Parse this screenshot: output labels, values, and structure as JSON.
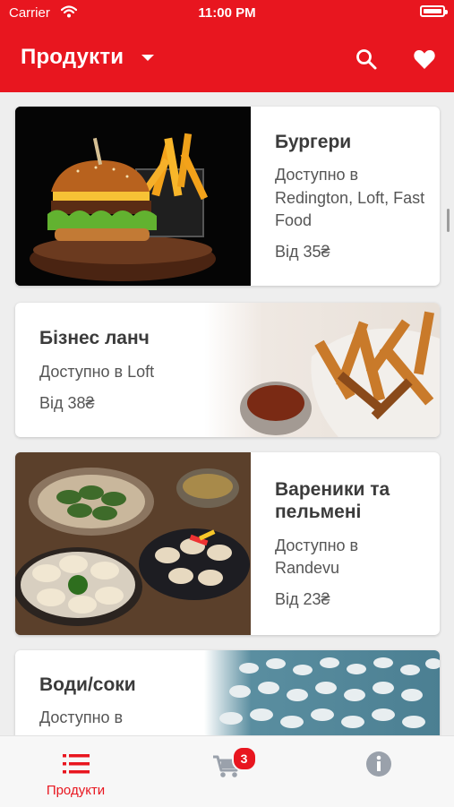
{
  "status_bar": {
    "carrier": "Carrier",
    "time": "11:00 PM"
  },
  "header": {
    "title": "Продукти",
    "accent_color": "#e8161f"
  },
  "products": [
    {
      "name": "Бургери",
      "availability": "Доступно в Redington, Loft, Fast Food",
      "price": "Від 35₴",
      "image_side": "left"
    },
    {
      "name": "Бізнес ланч",
      "availability": "Доступно в Loft",
      "price": "Від 38₴",
      "image_side": "right"
    },
    {
      "name": "Вареники та пельмені",
      "availability": "Доступно в Randevu",
      "price": "Від 23₴",
      "image_side": "left"
    },
    {
      "name": "Води/соки",
      "availability": "Доступно в",
      "image_side": "right"
    }
  ],
  "tabbar": {
    "products_label": "Продукти",
    "cart_badge": "3",
    "icons": [
      "list-icon",
      "cart-icon",
      "info-icon"
    ]
  }
}
